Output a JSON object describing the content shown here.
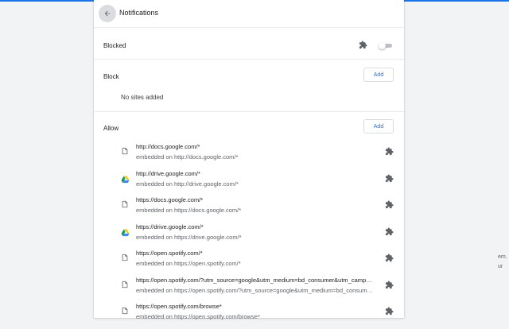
{
  "page": {
    "title": "Notifications",
    "accent": "#1a73e8"
  },
  "blocked": {
    "label": "Blocked",
    "toggle_on": false,
    "icon": "puzzle-icon"
  },
  "block": {
    "label": "Block",
    "add_label": "Add",
    "empty_text": "No sites added"
  },
  "allow": {
    "label": "Allow",
    "add_label": "Add",
    "sites": [
      {
        "url": "http://docs.google.com/*",
        "embedded": "embedded on http://docs.google.com/*",
        "icon": "document-icon"
      },
      {
        "url": "http://drive.google.com/*",
        "embedded": "embedded on http://drive.google.com/*",
        "icon": "google-drive-icon"
      },
      {
        "url": "https://docs.google.com/*",
        "embedded": "embedded on https://docs.google.com/*",
        "icon": "document-icon"
      },
      {
        "url": "https://drive.google.com/*",
        "embedded": "embedded on https://drive.google.com/*",
        "icon": "google-drive-icon"
      },
      {
        "url": "https://open.spotify.com/*",
        "embedded": "embedded on https://open.spotify.com/*",
        "icon": "document-icon"
      },
      {
        "url": "https://open.spotify.com/?utm_source=google&utm_medium=bd_consumer&utm_campai…",
        "embedded": "embedded on https://open.spotify.com/?utm_source=google&utm_medium=bd_consumer…",
        "icon": "document-icon"
      },
      {
        "url": "https://open.spotify.com/browse*",
        "embedded": "embedded on https://open.spotify.com/browse*",
        "icon": "document-icon"
      }
    ]
  },
  "side_text": [
    "em.",
    "ur"
  ]
}
